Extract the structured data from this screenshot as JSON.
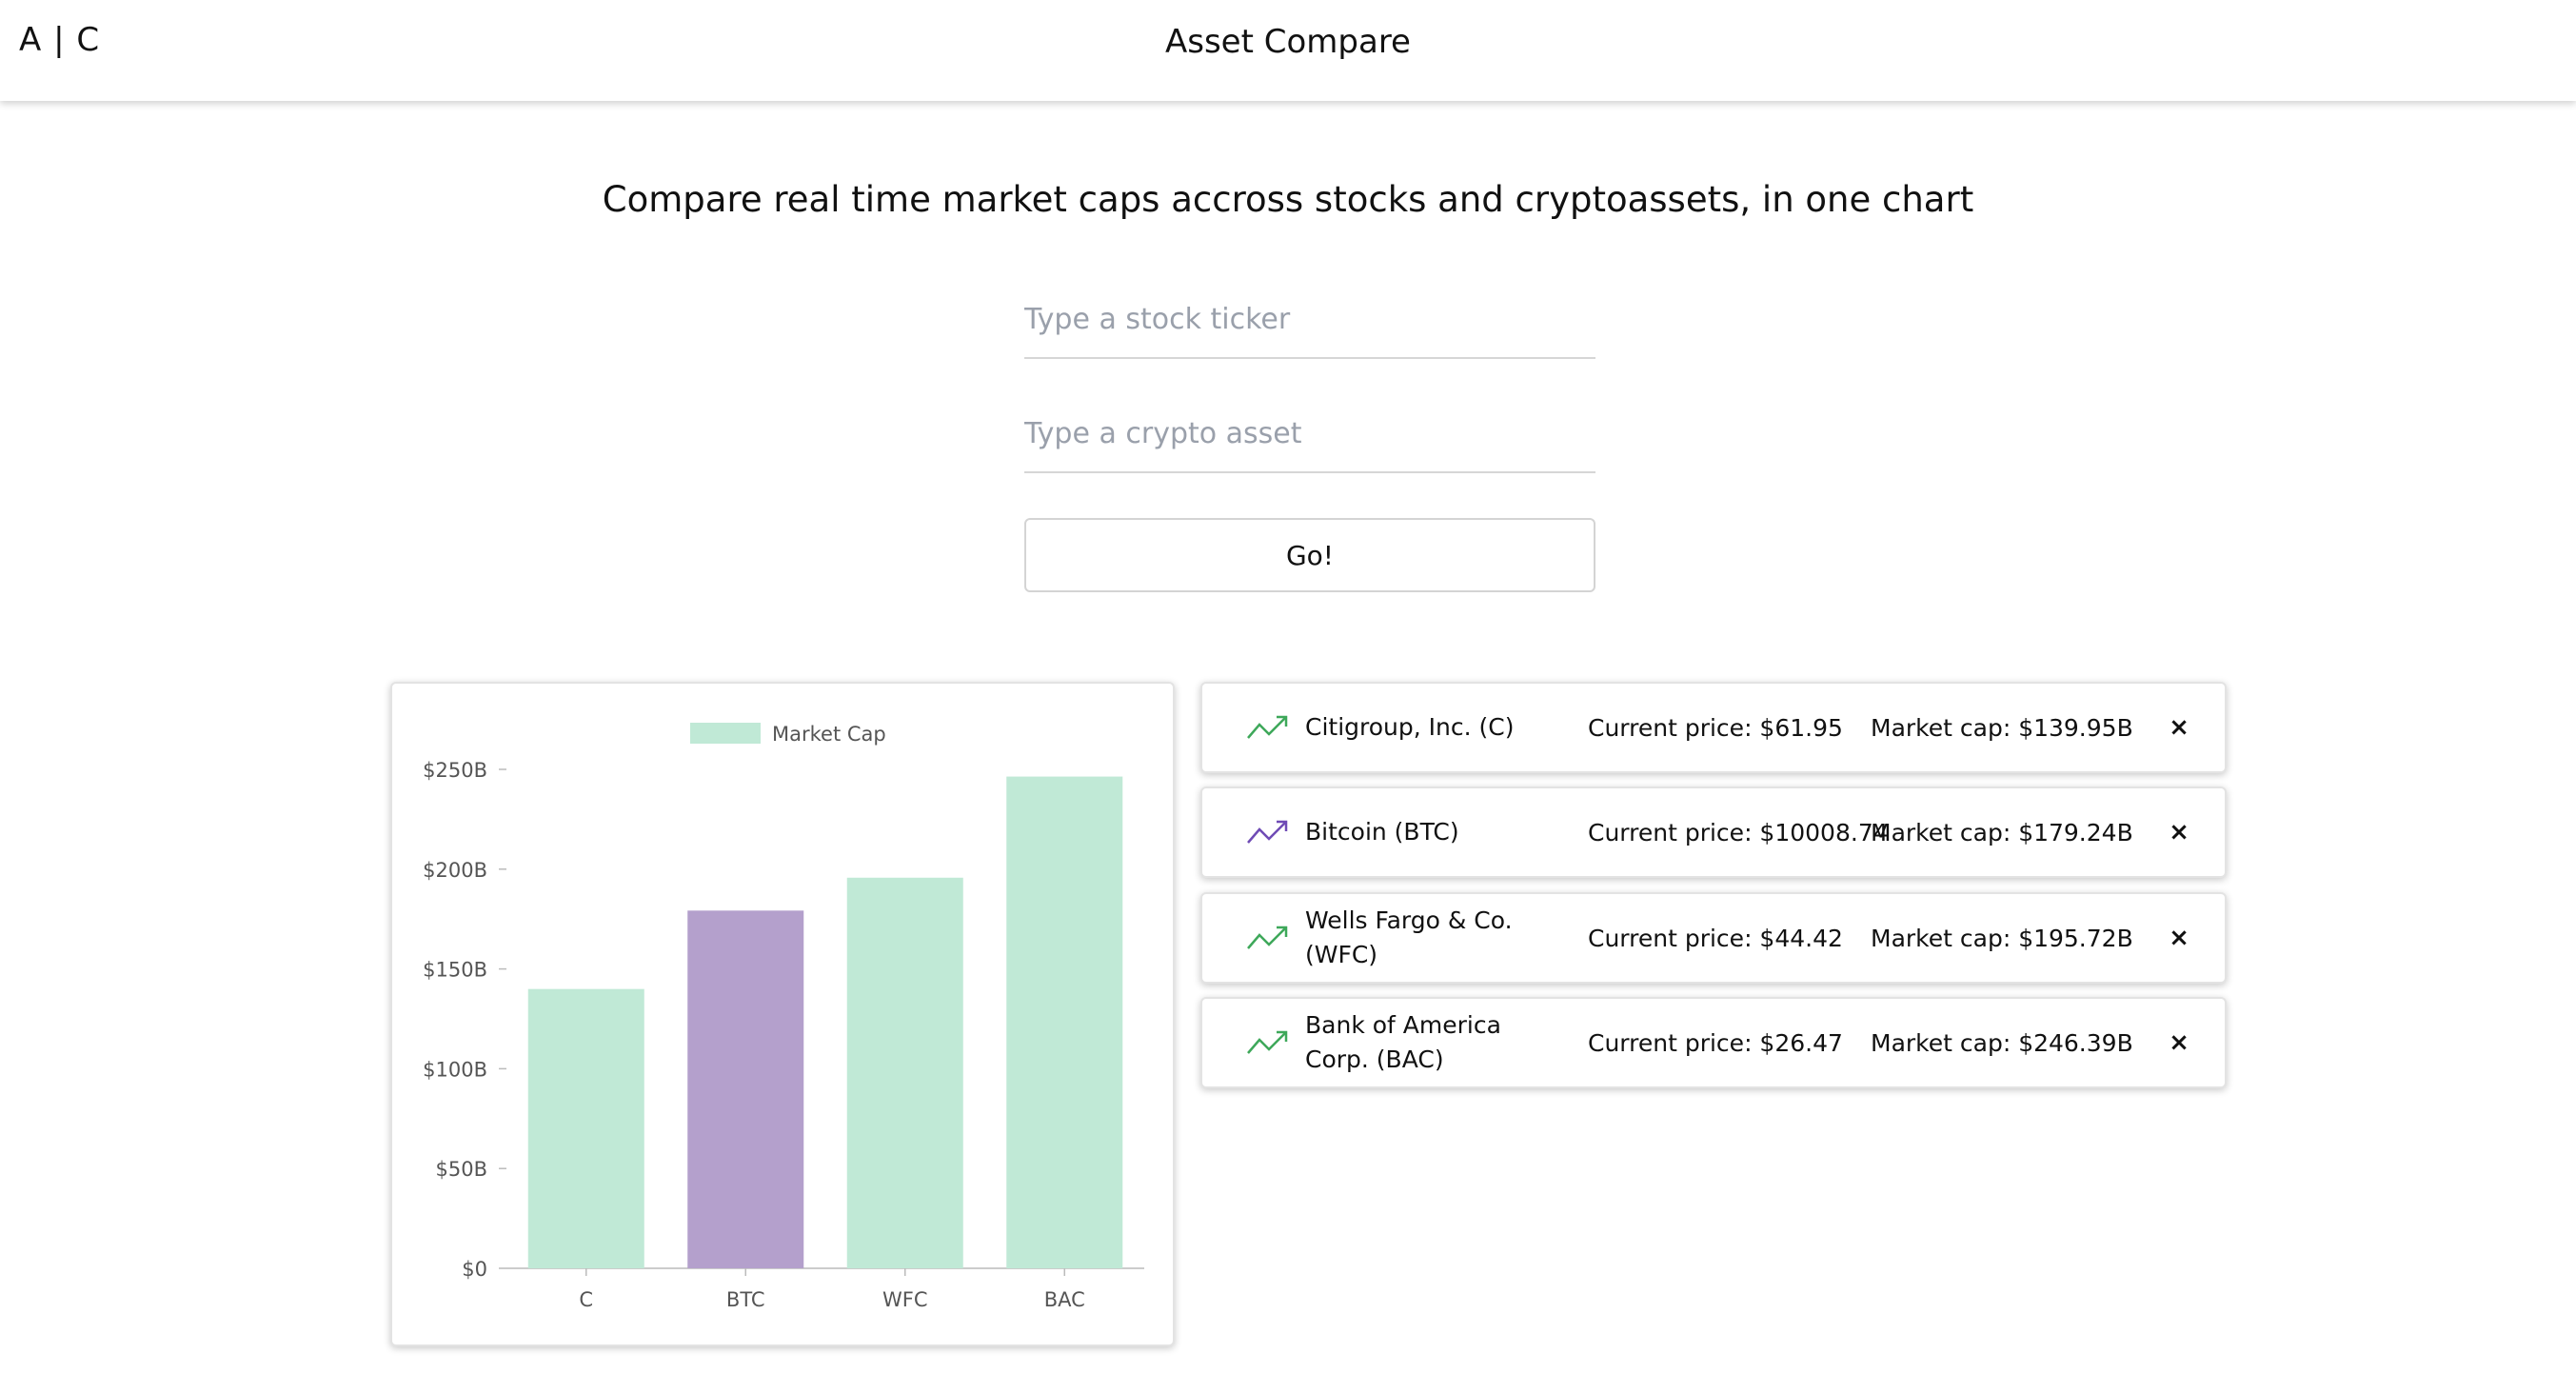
{
  "header": {
    "logo": "A | C",
    "title": "Asset Compare"
  },
  "main": {
    "headline": "Compare real time market caps accross stocks and cryptoassets, in one chart",
    "stock_placeholder": "Type a stock ticker",
    "crypto_placeholder": "Type a crypto asset",
    "go_label": "Go!"
  },
  "assets": [
    {
      "name": "Citigroup, Inc. (C)",
      "price": "Current price: $61.95",
      "cap": "Market cap: $139.95B",
      "remove": "×",
      "icon": "trending-up-icon",
      "color": "#3ea85a"
    },
    {
      "name": "Bitcoin (BTC)",
      "price": "Current price: $10008.74",
      "cap": "Market cap: $179.24B",
      "remove": "×",
      "icon": "trending-up-icon",
      "color": "#6f4bb5"
    },
    {
      "name": "Wells Fargo & Co. (WFC)",
      "price": "Current price: $44.42",
      "cap": "Market cap: $195.72B",
      "remove": "×",
      "icon": "trending-up-icon",
      "color": "#3ea85a"
    },
    {
      "name": "Bank of America Corp. (BAC)",
      "price": "Current price: $26.47",
      "cap": "Market cap: $246.39B",
      "remove": "×",
      "icon": "trending-up-icon",
      "color": "#3ea85a"
    }
  ],
  "chart_data": {
    "type": "bar",
    "categories": [
      "C",
      "BTC",
      "WFC",
      "BAC"
    ],
    "series": [
      {
        "name": "Market Cap",
        "values": [
          139.95,
          179.24,
          195.72,
          246.39
        ]
      }
    ],
    "unit": "B",
    "ylim": [
      0,
      250
    ],
    "yticks": [
      0,
      50,
      100,
      150,
      200,
      250
    ],
    "ytick_labels": [
      "$0",
      "$50B",
      "$100B",
      "$150B",
      "$200B",
      "$250B"
    ],
    "legend": "Market Cap",
    "legend_position": "top-center",
    "grid": false,
    "colors": {
      "stock": "#c0e9d6",
      "crypto": "#b4a0cc"
    },
    "bar_kinds": [
      "stock",
      "crypto",
      "stock",
      "stock"
    ]
  }
}
